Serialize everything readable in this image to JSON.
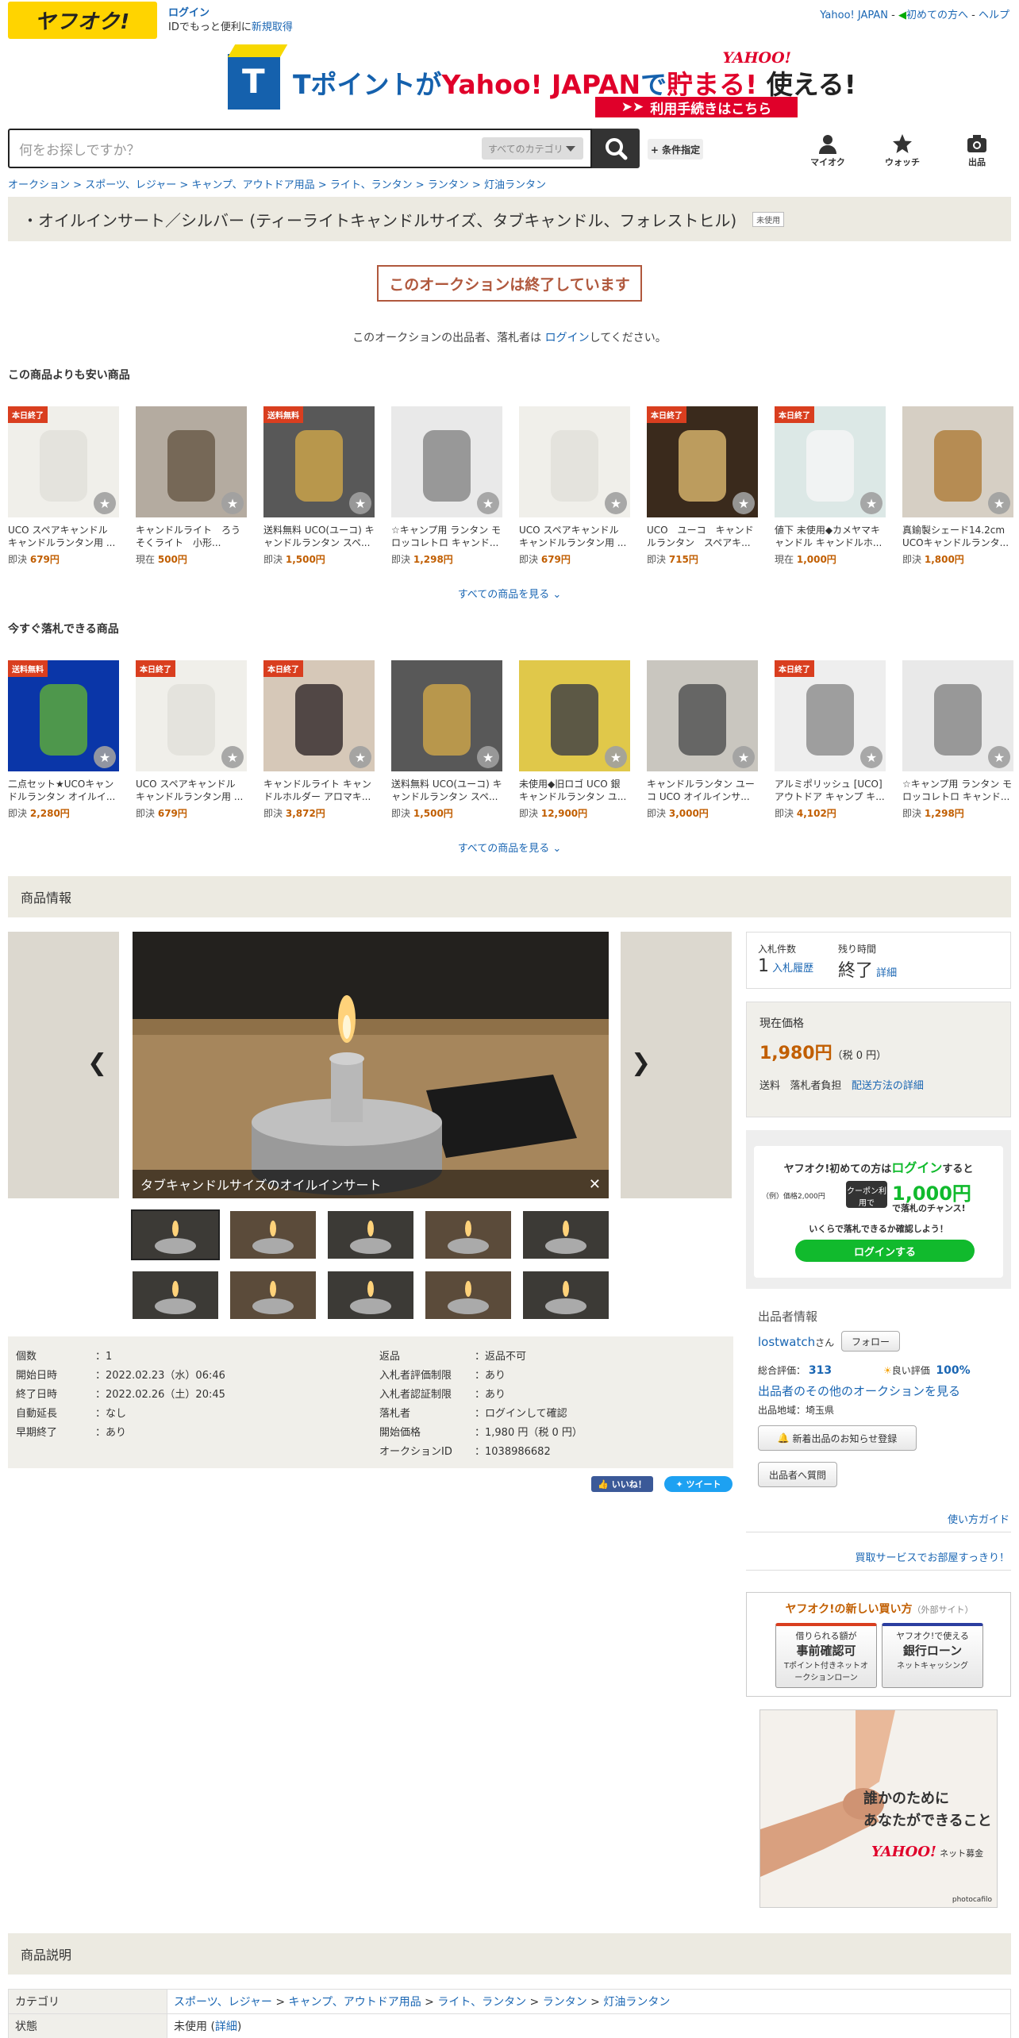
{
  "header": {
    "logo": "ヤフオク!",
    "login": "ログイン",
    "login_sub": "IDでもっと便利に",
    "register": "新規取得",
    "yahoo": "Yahoo! JAPAN",
    "sep": "-",
    "beginner": "初めての方へ",
    "help": "ヘルプ"
  },
  "banner": {
    "t": "T",
    "text_a": "Tポイントが",
    "text_b": "Yahoo! JAPAN",
    "text_c": "で",
    "text_d": "貯まる!",
    "text_e": "使える!",
    "brand": "YAHOO!",
    "btn": "利用手続きはこちら"
  },
  "search": {
    "placeholder": "何をお探しですか？",
    "category": "すべてのカテゴリ",
    "cond": "+ 条件指定",
    "nav": [
      "マイオク",
      "ウォッチ",
      "出品"
    ]
  },
  "breadcrumb": [
    "オークション",
    "スポーツ、レジャー",
    "キャンプ、アウトドア用品",
    "ライト、ランタン",
    "ランタン",
    "灯油ランタン"
  ],
  "title": "・オイルインサート／シルバー (ティーライトキャンドルサイズ、タブキャンドル、フォレストヒル)",
  "condition_badge": "未使用",
  "ended": "このオークションは終了しています",
  "notice": {
    "a": "このオークションの出品者、落札者は",
    "link": "ログイン",
    "b": "してください。"
  },
  "cheaper": {
    "heading": "この商品よりも安い商品",
    "see_all": "すべての商品を見る",
    "items": [
      {
        "ribbon": "本日終了",
        "name": "UCO スペアキャンドル キャンドルランタン用 ...",
        "type": "即決",
        "price": "679円"
      },
      {
        "ribbon": "",
        "name": "キャンドルライト　ろうそくライト　小形...",
        "type": "現在",
        "price": "500円"
      },
      {
        "ribbon": "送料無料",
        "name": "送料無料 UCO(ユーコ) キャンドルランタン スペ...",
        "type": "即決",
        "price": "1,500円"
      },
      {
        "ribbon": "",
        "name": "☆キャンプ用 ランタン モロッコレトロ キャンド...",
        "type": "即決",
        "price": "1,298円"
      },
      {
        "ribbon": "",
        "name": "UCO スペアキャンドル キャンドルランタン用 ...",
        "type": "即決",
        "price": "679円"
      },
      {
        "ribbon": "本日終了",
        "name": "UCO　ユーコ　キャンドルランタン　スペアキ...",
        "type": "即決",
        "price": "715円"
      },
      {
        "ribbon": "本日終了",
        "name": "値下 未使用◆カメヤマキャンドル キャンドルホ...",
        "type": "現在",
        "price": "1,000円"
      },
      {
        "ribbon": "",
        "name": "真鍮製シェード14.2cm UCOキャンドルランタ...",
        "type": "即決",
        "price": "1,800円"
      }
    ]
  },
  "buynow": {
    "heading": "今すぐ落札できる商品",
    "see_all": "すべての商品を見る",
    "items": [
      {
        "ribbon": "送料無料",
        "name": "二点セット★UCOキャンドルランタン オイルイ...",
        "type": "即決",
        "price": "2,280円"
      },
      {
        "ribbon": "本日終了",
        "name": "UCO スペアキャンドル キャンドルランタン用 ...",
        "type": "即決",
        "price": "679円"
      },
      {
        "ribbon": "本日終了",
        "name": "キャンドルライト キャンドルホルダー アロマキ...",
        "type": "即決",
        "price": "3,872円"
      },
      {
        "ribbon": "",
        "name": "送料無料 UCO(ユーコ) キャンドルランタン スペ...",
        "type": "即決",
        "price": "1,500円"
      },
      {
        "ribbon": "",
        "name": "未使用◆旧ロゴ UCO 銀 キャンドルランタン ユ...",
        "type": "即決",
        "price": "12,900円"
      },
      {
        "ribbon": "",
        "name": "キャンドルランタン ユーコ UCO オイルインサ...",
        "type": "即決",
        "price": "3,000円"
      },
      {
        "ribbon": "本日終了",
        "name": "アルミポリッシュ [UCO] アウトドア キャンプ キ...",
        "type": "即決",
        "price": "4,102円"
      },
      {
        "ribbon": "",
        "name": "☆キャンプ用 ランタン モロッコレトロ キャンド...",
        "type": "即決",
        "price": "1,298円"
      }
    ]
  },
  "info_heading": "商品情報",
  "gallery": {
    "caption": "タブキャンドルサイズのオイルインサート"
  },
  "specs": {
    "left": [
      [
        "個数",
        "：1"
      ],
      [
        "開始日時",
        "：2022.02.23（水）06:46"
      ],
      [
        "終了日時",
        "：2022.02.26（土）20:45"
      ],
      [
        "自動延長",
        "：なし"
      ],
      [
        "早期終了",
        "：あり"
      ]
    ],
    "right": [
      [
        "返品",
        "：返品不可"
      ],
      [
        "入札者評価制限",
        "：あり"
      ],
      [
        "入札者認証制限",
        "：あり"
      ],
      [
        "落札者",
        "：ログインして確認"
      ],
      [
        "開始価格",
        "：1,980 円（税 0 円）"
      ],
      [
        "オークションID",
        "：1038986682"
      ]
    ]
  },
  "social": {
    "like": "いいね！",
    "tweet": "ツイート"
  },
  "bid": {
    "count_label": "入札件数",
    "count": "1",
    "history": "入札履歴",
    "time_label": "残り時間",
    "time": "終了",
    "detail": "詳細"
  },
  "price": {
    "label": "現在価格",
    "value": "1,980円",
    "tax": "（税 0 円）",
    "ship_label": "送料",
    "ship": "落札者負担",
    "ship_link": "配送方法の詳細"
  },
  "promo": {
    "line1a": "ヤフオク!初めての方は",
    "line1b": "ログイン",
    "line1c": "すると",
    "ex": "（例）価格2,000円",
    "coupon": "クーポン利用で",
    "amount": "1,000円",
    "off": "で落札のチャンス!",
    "line3": "いくらで落札できるか確認しよう！",
    "btn": "ログインする"
  },
  "seller": {
    "heading": "出品者情報",
    "name": "lostwatch",
    "san": "さん",
    "follow": "フォロー",
    "rating_label": "総合評価：",
    "rating": "313",
    "good_label": "良い評価",
    "good": "100%",
    "other": "出品者のその他のオークションを見る",
    "region": "出品地域：埼玉県",
    "notify": "新着出品のお知らせ登録",
    "ask": "出品者へ質問"
  },
  "links": {
    "guide": "使い方ガイド",
    "buyer": "買取サービスでお部屋すっきり！"
  },
  "loan": {
    "title": "ヤフオク!の新しい買い方",
    "ext": "（外部サイト）",
    "c1a": "借りられる額が",
    "c1b": "事前確認可",
    "c1c": "Tポイント付きネットオークションローン",
    "c2a": "ヤフオク!で使える",
    "c2b": "銀行ローン",
    "c2c": "ネットキャッシング"
  },
  "ad": {
    "line1": "誰かのために",
    "line2": "あなたができること",
    "brand": "YAHOO!",
    "sub": "ネット募金",
    "credit": "photocafilo"
  },
  "desc_heading": "商品説明",
  "desc_table": {
    "cat_label": "カテゴリ",
    "cat": [
      "スポーツ、レジャー",
      "キャンプ、アウトドア用品",
      "ライト、ランタン",
      "ランタン",
      "灯油ランタン"
    ],
    "state_label": "状態",
    "state": "未使用",
    "state_detail": "詳細"
  }
}
